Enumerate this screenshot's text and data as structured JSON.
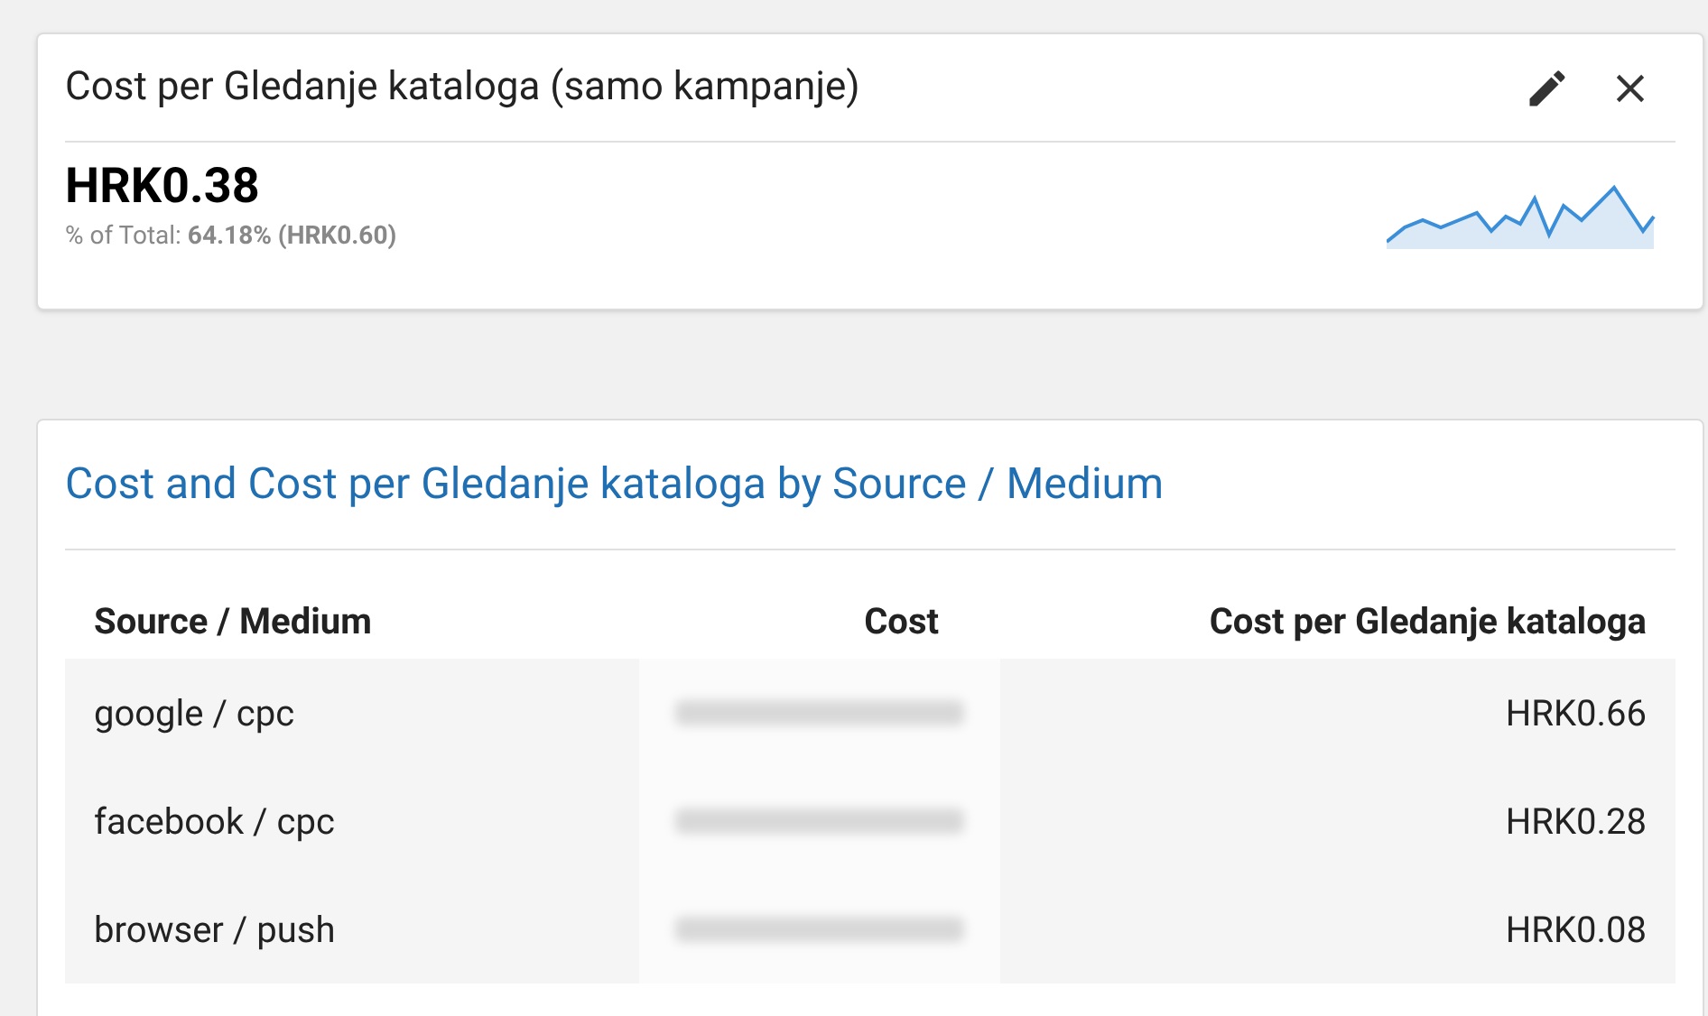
{
  "metric_card": {
    "title": "Cost per Gledanje kataloga (samo kampanje)",
    "value": "HRK0.38",
    "total": "% of Total: **64.18% (HRK0.60)**"
  },
  "table_card": {
    "title": "Cost and Cost per Gledanje kataloga by Source / Medium",
    "columns": [
      "Source / Medium",
      "Cost",
      "Cost per Gledanje kataloga"
    ],
    "rows": [
      {
        "source": "google / cpc",
        "cost_blurred": true,
        "cost_per": "HRK0.66"
      },
      {
        "source": "facebook / cpc",
        "cost_blurred": true,
        "cost_per": "HRK0.28"
      },
      {
        "source": "browser / push",
        "cost_blurred": true,
        "cost_per": "HRK0.08"
      }
    ]
  }
}
